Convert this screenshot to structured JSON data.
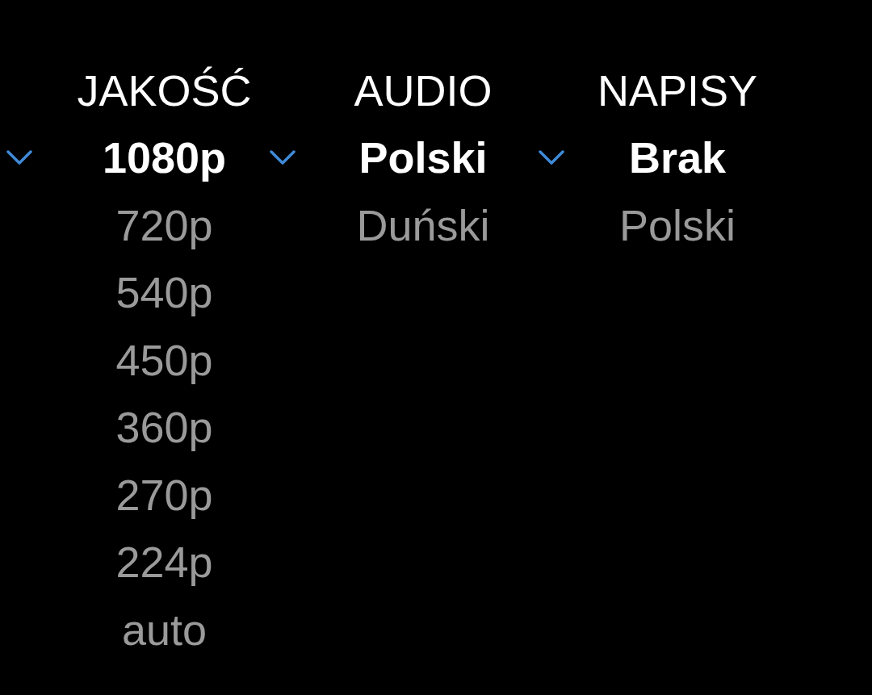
{
  "sections": [
    {
      "title": "JAKOŚĆ",
      "options": [
        {
          "label": "1080p",
          "selected": true
        },
        {
          "label": "720p",
          "selected": false
        },
        {
          "label": "540p",
          "selected": false
        },
        {
          "label": "450p",
          "selected": false
        },
        {
          "label": "360p",
          "selected": false
        },
        {
          "label": "270p",
          "selected": false
        },
        {
          "label": "224p",
          "selected": false
        },
        {
          "label": "auto",
          "selected": false
        }
      ]
    },
    {
      "title": "AUDIO",
      "options": [
        {
          "label": "Polski",
          "selected": true
        },
        {
          "label": "Duński",
          "selected": false
        }
      ]
    },
    {
      "title": "NAPISY",
      "options": [
        {
          "label": "Brak",
          "selected": true
        },
        {
          "label": "Polski",
          "selected": false
        }
      ]
    }
  ]
}
